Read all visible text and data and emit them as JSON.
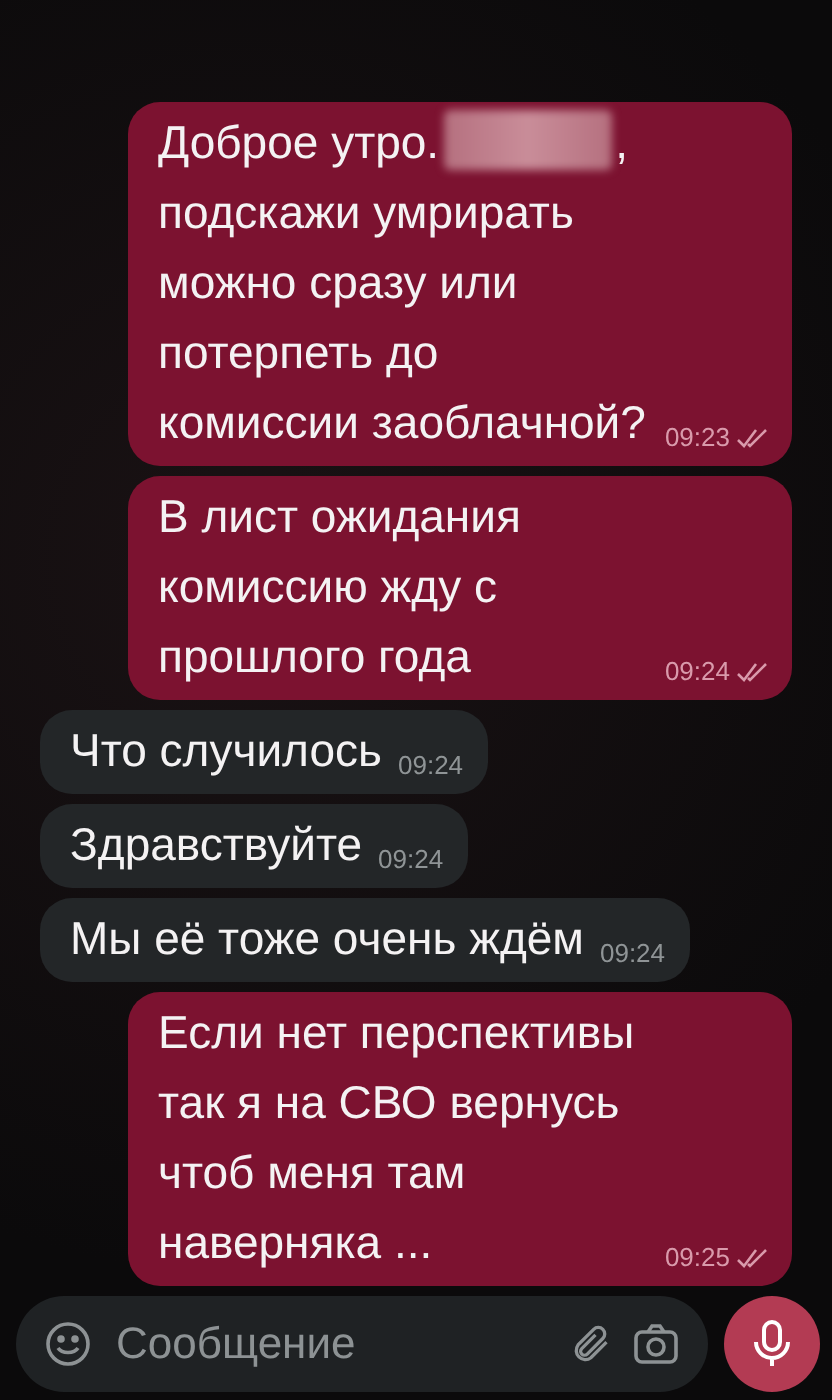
{
  "messages": [
    {
      "kind": "redacted",
      "outgoing": true,
      "before": "Доброе утро.",
      "after": ", подскажи умрирать можно сразу или потерпеть до комиссии заоблачной?",
      "time": "09:23",
      "read": true
    },
    {
      "kind": "plain",
      "outgoing": true,
      "text": "В лист ожидания комиссию жду с прошлого года",
      "time": "09:24",
      "read": true
    },
    {
      "kind": "plain",
      "outgoing": false,
      "text": "Что случилось",
      "time": "09:24",
      "read": false
    },
    {
      "kind": "plain",
      "outgoing": false,
      "text": "Здравствуйте",
      "time": "09:24",
      "read": false
    },
    {
      "kind": "plain",
      "outgoing": false,
      "text": "Мы её тоже очень ждём",
      "time": "09:24",
      "read": false
    },
    {
      "kind": "plain",
      "outgoing": true,
      "text": "Если нет перспективы так я на СВО вернусь чтоб меня там наверняка ...",
      "time": "09:25",
      "read": true
    }
  ],
  "composer": {
    "placeholder": "Сообщение"
  }
}
